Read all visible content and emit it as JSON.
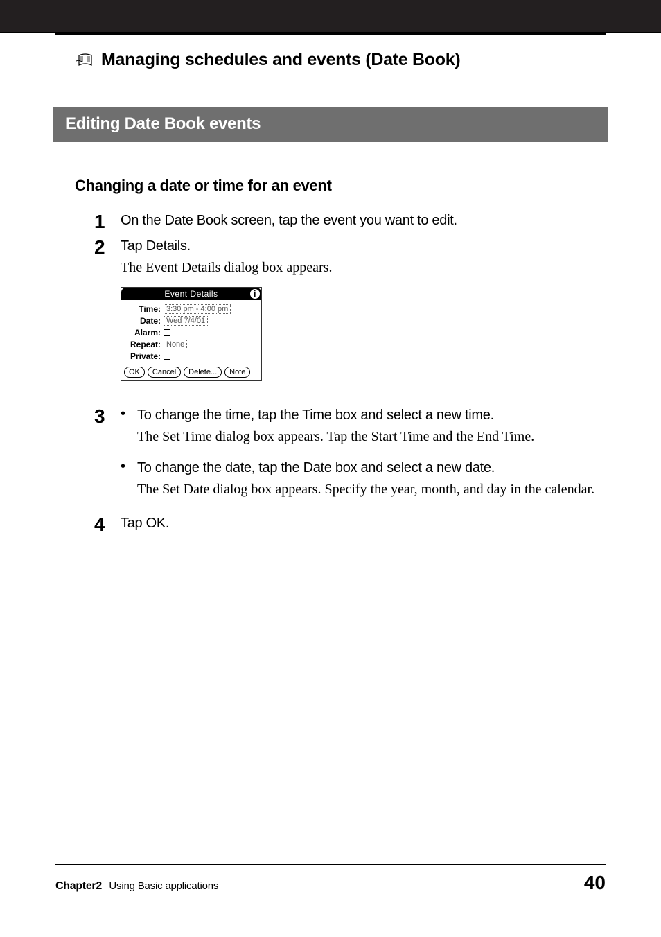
{
  "header": {
    "chapter_icon": "date-book-icon",
    "chapter_title": "Managing schedules and events (Date Book)"
  },
  "section": {
    "title": "Editing Date Book events"
  },
  "subsection": {
    "title": "Changing a date or time for an event"
  },
  "steps": {
    "s1": {
      "num": "1",
      "primary": "On the Date Book screen, tap the event you want to edit."
    },
    "s2": {
      "num": "2",
      "primary": "Tap Details.",
      "note": "The Event Details dialog box appears."
    },
    "s3": {
      "num": "3",
      "bullets": [
        {
          "primary": "To change the time, tap the Time box and select a new time.",
          "note": "The Set Time dialog box appears. Tap the Start Time and the End Time."
        },
        {
          "primary": "To change the date, tap the Date box and select a new date.",
          "note": "The Set Date dialog box appears. Specify the year, month, and day in the calendar."
        }
      ]
    },
    "s4": {
      "num": "4",
      "primary": "Tap OK."
    }
  },
  "dialog": {
    "title": "Event Details",
    "info_glyph": "i",
    "labels": {
      "time": "Time:",
      "date": "Date:",
      "alarm": "Alarm:",
      "repeat": "Repeat:",
      "private": "Private:"
    },
    "values": {
      "time": "3:30 pm - 4:00 pm",
      "date": "Wed 7/4/01",
      "repeat": "None"
    },
    "buttons": {
      "ok": "OK",
      "cancel": "Cancel",
      "delete": "Delete...",
      "note": "Note"
    }
  },
  "footer": {
    "chapter_label": "Chapter2",
    "chapter_name": "Using Basic applications",
    "page_number": "40"
  }
}
